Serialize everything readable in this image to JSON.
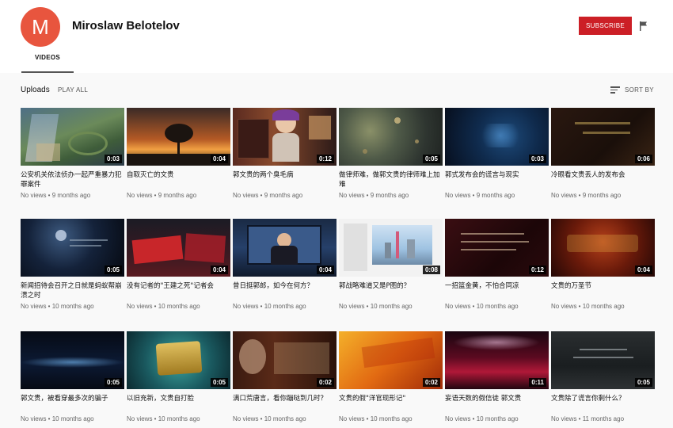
{
  "channel": {
    "avatar_letter": "M",
    "name": "Miroslaw Belotelov",
    "subscribe_label": "SUBSCRIBE"
  },
  "tabs": {
    "videos": "VIDEOS"
  },
  "uploads": {
    "heading": "Uploads",
    "play_all": "PLAY ALL",
    "sort_by": "SORT BY"
  },
  "colors": {
    "subscribe": "#cc1f26",
    "avatar": "#e8553e"
  },
  "videos": [
    {
      "title": "公安机关依法侦办一起严重暴力犯罪案件",
      "duration": "0:03",
      "meta": "No views • 9 months ago",
      "thumb": "thumb-city-aerial"
    },
    {
      "title": "自取灭亡的文贵",
      "duration": "0:04",
      "meta": "No views • 9 months ago",
      "thumb": "thumb-sunset-tree"
    },
    {
      "title": "郭文贵的两个臭毛病",
      "duration": "0:12",
      "meta": "No views • 9 months ago",
      "thumb": "thumb-cartoon-news"
    },
    {
      "title": "做律师难，做郭文贵的律师难上加难",
      "duration": "0:05",
      "meta": "No views • 9 months ago",
      "thumb": "thumb-bokeh"
    },
    {
      "title": "郭式发布会的谎言与现实",
      "duration": "0:03",
      "meta": "No views • 9 months ago",
      "thumb": "thumb-blue-particles"
    },
    {
      "title": "冷眼看文贵丢人的发布会",
      "duration": "0:06",
      "meta": "No views • 9 months ago",
      "thumb": "thumb-dark-text"
    },
    {
      "title": "新闻招待会召开之日就是蚂蚁帮崩溃之时",
      "duration": "0:05",
      "meta": "No views • 10 months ago",
      "thumb": "thumb-night-text"
    },
    {
      "title": "没有记者的\"王建之死\"记者会",
      "duration": "0:04",
      "meta": "No views • 10 months ago",
      "thumb": "thumb-red-title"
    },
    {
      "title": "昔日挺郭郎，如今在何方？",
      "duration": "0:04",
      "meta": "No views • 10 months ago",
      "thumb": "thumb-speaker"
    },
    {
      "title": "郭战略难道又是P图的？",
      "duration": "0:08",
      "meta": "No views • 10 months ago",
      "thumb": "thumb-skyline"
    },
    {
      "title": "一招篮金黄，不怕合同凉",
      "duration": "0:12",
      "meta": "No views • 10 months ago",
      "thumb": "thumb-red-text"
    },
    {
      "title": "文贵的万圣节",
      "duration": "0:04",
      "meta": "No views • 10 months ago",
      "thumb": "thumb-fire-title"
    },
    {
      "title": "郭文贵，被看穿最多次的骗子",
      "duration": "0:05",
      "meta": "No views • 10 months ago",
      "thumb": "thumb-blue-wave"
    },
    {
      "title": "以旧充新，文贵自打脸",
      "duration": "0:05",
      "meta": "No views • 10 months ago",
      "thumb": "thumb-gold-plaque"
    },
    {
      "title": "满口荒唐言，看你蹦哒到几时？",
      "duration": "0:02",
      "meta": "No views • 10 months ago",
      "thumb": "thumb-face-title"
    },
    {
      "title": "文贵的假\"洋官现形记\"",
      "duration": "0:02",
      "meta": "No views • 10 months ago",
      "thumb": "thumb-orange-title"
    },
    {
      "title": "妄语天数的假信徒 郭文贵",
      "duration": "0:11",
      "meta": "No views • 10 months ago",
      "thumb": "thumb-stage-lights"
    },
    {
      "title": "文贵除了谎言你剩什么？",
      "duration": "0:05",
      "meta": "No views • 11 months ago",
      "thumb": "thumb-grey-text"
    }
  ]
}
